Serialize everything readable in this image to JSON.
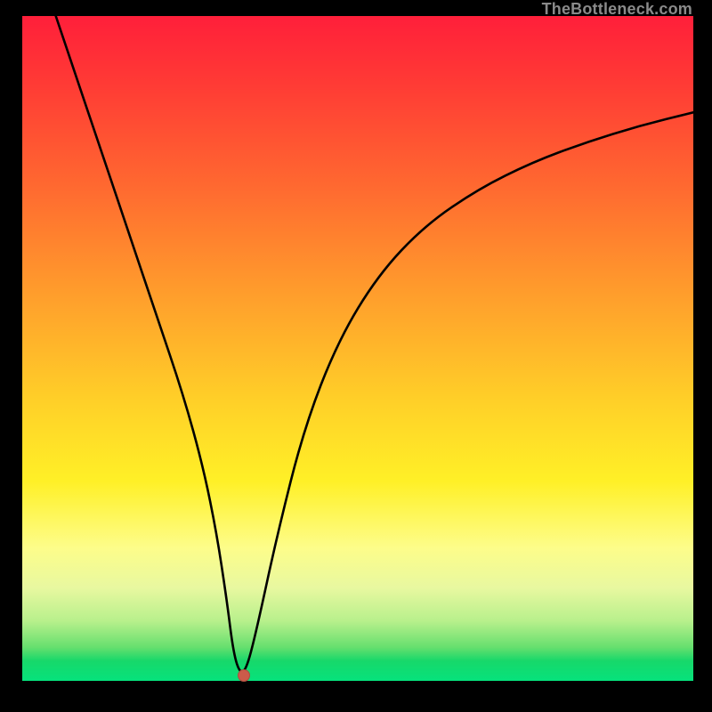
{
  "watermark": {
    "text": "TheBottleneck.com"
  },
  "chart_data": {
    "type": "line",
    "title": "",
    "xlabel": "",
    "ylabel": "",
    "xlim": [
      0,
      100
    ],
    "ylim": [
      0,
      100
    ],
    "grid": false,
    "legend": false,
    "series": [
      {
        "name": "bottleneck-curve",
        "x": [
          5,
          8,
          12,
          16,
          20,
          24,
          27,
          29,
          30.5,
          31.5,
          32.5,
          33.5,
          35,
          38,
          42,
          47,
          53,
          60,
          68,
          76,
          84,
          92,
          100
        ],
        "y": [
          100,
          91,
          79,
          67,
          55,
          43,
          32,
          22,
          12,
          4,
          1,
          2,
          8,
          22,
          38,
          51,
          61,
          68.5,
          74,
          78,
          81,
          83.5,
          85.5
        ]
      }
    ],
    "marker": {
      "x": 33,
      "y": 0.8,
      "color": "#cc5b4a"
    },
    "gradient_stops": [
      {
        "pos": 0.0,
        "color": "#ff1f3a"
      },
      {
        "pos": 0.26,
        "color": "#ff6a30"
      },
      {
        "pos": 0.58,
        "color": "#ffd028"
      },
      {
        "pos": 0.8,
        "color": "#fdfd8a"
      },
      {
        "pos": 0.95,
        "color": "#65df6e"
      },
      {
        "pos": 1.0,
        "color": "#06e27c"
      }
    ]
  }
}
